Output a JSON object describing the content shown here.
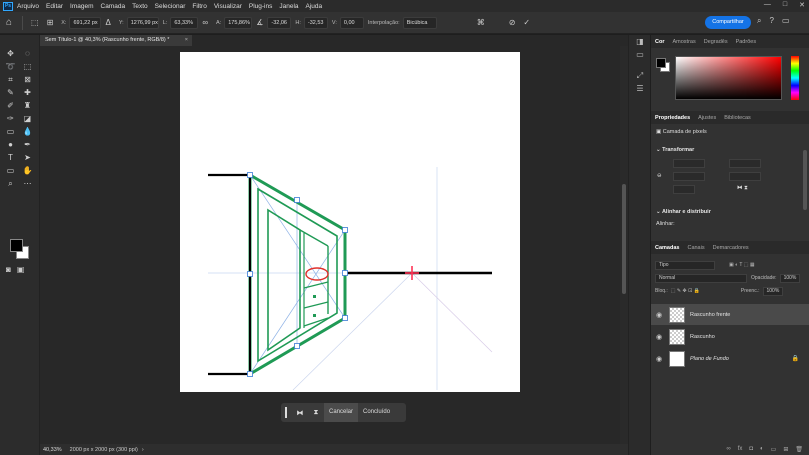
{
  "app": {
    "logo": "Ps"
  },
  "menu": [
    "Arquivo",
    "Editar",
    "Imagem",
    "Camada",
    "Texto",
    "Selecionar",
    "Filtro",
    "Visualizar",
    "Plug-ins",
    "Janela",
    "Ajuda"
  ],
  "window_controls": [
    "—",
    "□",
    "✕"
  ],
  "options_bar": {
    "x_label": "X:",
    "x_value": "691,22 px",
    "y_label": "Y:",
    "y_value": "1276,99 px",
    "w_label": "L:",
    "w_value": "63,33%",
    "h_label": "A:",
    "h_value": "175,86%",
    "angle_value": "-32,06",
    "hskew_label": "H:",
    "hskew_value": "-32,53",
    "vskew_label": "V:",
    "vskew_value": "0,00",
    "interp_label": "Interpolação:",
    "interp_value": "Bicúbica",
    "share_label": "Compartilhar"
  },
  "document": {
    "tab_title": "Sem Título-1 @ 40,3% (Rascunho frente, RGB/8) *"
  },
  "transform_bar": {
    "cancel": "Cancelar",
    "done": "Concluído"
  },
  "status": {
    "zoom": "40,33%",
    "info": "2000 px x 2000 px (300 ppi)"
  },
  "color_panel": {
    "tabs": [
      "Cor",
      "Amostras",
      "Degradês",
      "Padrões"
    ],
    "foreground": "#000000",
    "background": "#ffffff",
    "hue": "#ff0000"
  },
  "properties_panel": {
    "tabs": [
      "Propriedades",
      "Ajustes",
      "Bibliotecas"
    ],
    "layer_type": "Camada de pixels",
    "transform_heading": "Transformar",
    "align_heading": "Alinhar e distribuir",
    "align_label": "Alinhar:"
  },
  "layers_panel": {
    "tabs": [
      "Camadas",
      "Canais",
      "Demarcadores"
    ],
    "filter_placeholder": "Tipo",
    "blend_mode": "Normal",
    "opacity_label": "Opacidade:",
    "opacity_value": "100%",
    "lock_label": "Bloq.:",
    "fill_label": "Preenc.:",
    "fill_value": "100%",
    "layers": [
      {
        "name": "Rascunho frente",
        "selected": true
      },
      {
        "name": "Rascunho",
        "selected": false
      },
      {
        "name": "Plano de Fundo",
        "selected": false,
        "locked": true
      }
    ]
  }
}
